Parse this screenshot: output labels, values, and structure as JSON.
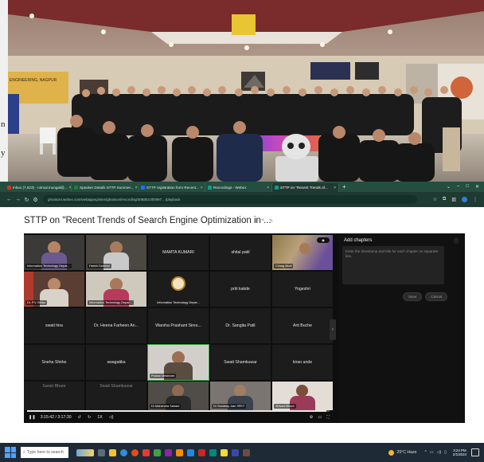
{
  "photo": {
    "left_strip_chars": [
      "n",
      "y"
    ],
    "banner_text": "ENGINEERING, NAGPUR"
  },
  "browser": {
    "tabs": [
      {
        "label": "Inbox (7,623) - nirmal.mungal@...",
        "color": "#d93025",
        "active": false
      },
      {
        "label": "Speaker Details STTP Summer...",
        "color": "#188038",
        "active": false
      },
      {
        "label": "STTP registration form Recent...",
        "color": "#1a73e8",
        "active": false
      },
      {
        "label": "Recordings - Webex",
        "color": "#0a9e8f",
        "active": false
      },
      {
        "label": "STTP on \"Recent Trends of...",
        "color": "#0a9e8f",
        "active": true
      }
    ],
    "url": "ghraisoni.webex.com/webappng/sites/ghraisoni/recording/308d61c0f4997..../playback"
  },
  "page": {
    "title": "STTP on \"Recent Trends of Search Engine Optimization in ..."
  },
  "participants": [
    {
      "name": "Information Technology Depar...",
      "type": "video"
    },
    {
      "name": "Harish Dahiwal",
      "type": "video"
    },
    {
      "name": "MAMTA KUMARI",
      "type": "name"
    },
    {
      "name": "shital patil",
      "type": "name"
    },
    {
      "name": "Chirag Modi",
      "type": "video"
    },
    {
      "name": "Dr. P.V. Belsa",
      "type": "video"
    },
    {
      "name": "Information Technology Depar...",
      "type": "video"
    },
    {
      "name": "Information Technology Depar...",
      "type": "logo"
    },
    {
      "name": "priti kakde",
      "type": "name"
    },
    {
      "name": "Yogeshri",
      "type": "name"
    },
    {
      "name": "swati hira",
      "type": "name"
    },
    {
      "name": "Dr. Heena Farheen An...",
      "type": "name"
    },
    {
      "name": "Warsha Prashant Sires...",
      "type": "name"
    },
    {
      "name": "Dr. Sangita Patil",
      "type": "name"
    },
    {
      "name": "Arti Buche",
      "type": "name"
    },
    {
      "name": "Sneha Shirke",
      "type": "name"
    },
    {
      "name": "swagatika",
      "type": "name"
    },
    {
      "name": "Pranav Meshram",
      "type": "video"
    },
    {
      "name": "Swati Shamkuwar",
      "type": "name"
    },
    {
      "name": "kiran ande",
      "type": "name"
    },
    {
      "name": "Sarah Bhure",
      "type": "name"
    },
    {
      "name": "Swati Shamkuwar",
      "type": "name"
    },
    {
      "name": "Dr Mahendra Sahare",
      "type": "video"
    },
    {
      "name": "Dr Sandeep Jain SPKT",
      "type": "video"
    },
    {
      "name": "Shivani Bhure",
      "type": "video"
    }
  ],
  "player": {
    "time": "3:15:42 / 3:17:30",
    "speed": "1X",
    "progress": 0.99
  },
  "chapters": {
    "heading": "Add chapters",
    "placeholder": "Enter the timestamp and title for each chapter on separate line.",
    "save": "Save",
    "cancel": "Cancel"
  },
  "taskbar": {
    "search_placeholder": "Type here to search",
    "weather": "29°C Haze",
    "time": "3:24 PM",
    "date": "2/1/2024"
  }
}
